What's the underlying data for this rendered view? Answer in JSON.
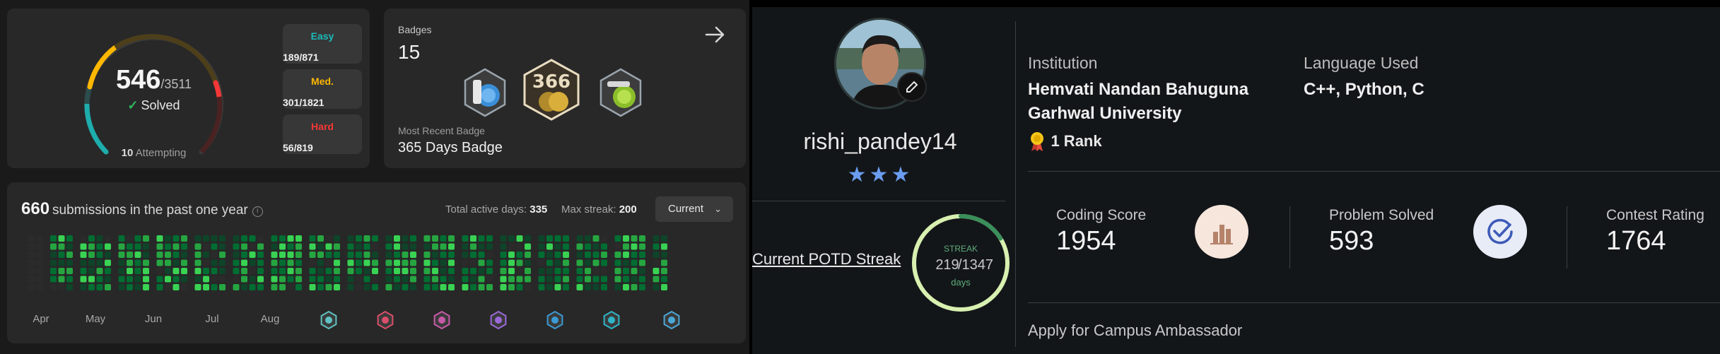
{
  "leetcode": {
    "solved": {
      "count": "546",
      "total": "/3511",
      "label": "Solved",
      "attempting_count": "10",
      "attempting_label": " Attempting"
    },
    "difficulty": [
      {
        "label": "Easy",
        "value": "189/871",
        "color": "#1cbaba"
      },
      {
        "label": "Med.",
        "value": "301/1821",
        "color": "#ffb700"
      },
      {
        "label": "Hard",
        "value": "56/819",
        "color": "#f63737"
      }
    ],
    "badges": {
      "title": "Badges",
      "count": "15",
      "recent_title": "Most Recent Badge",
      "recent_name": "365 Days Badge"
    },
    "heatmap": {
      "count": "660",
      "label": "submissions in the past one year",
      "active_label": "Total active days: ",
      "active_value": "335",
      "streak_label": "Max streak: ",
      "streak_value": "200",
      "select": "Current",
      "months": [
        "Apr",
        "May",
        "Jun",
        "Jul",
        "Aug"
      ]
    }
  },
  "gfg": {
    "username": "rishi_pandey14",
    "stars": "★★★",
    "potd_link": "Current POTD Streak",
    "streak_label": "STREAK",
    "streak_value": "219",
    "streak_total": "/1347",
    "streak_unit": "days",
    "streak_fraction": 0.1626,
    "institution_label": "Institution",
    "institution": "Hemvati Nandan Bahuguna Garhwal University",
    "language_label": "Language Used",
    "languages": "C++, Python, C",
    "rank": "1 Rank",
    "coding_score_label": "Coding Score",
    "coding_score": "1954",
    "problems_label": "Problem Solved",
    "problems": "593",
    "contest_label": "Contest Rating",
    "contest": "1764",
    "apply": "Apply for Campus Ambassador"
  }
}
